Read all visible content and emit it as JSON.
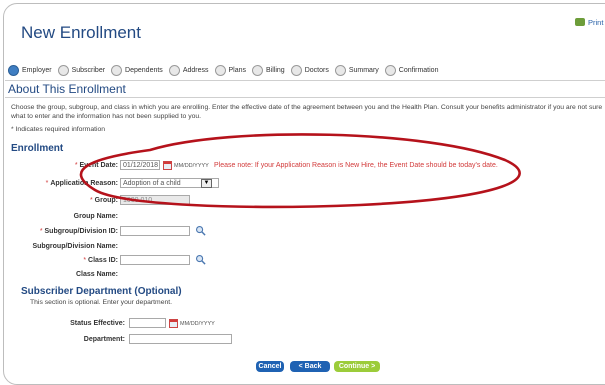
{
  "page": {
    "title": "New Enrollment",
    "print_label": "Print this pa"
  },
  "steps": [
    {
      "label": "Employer",
      "active": true
    },
    {
      "label": "Subscriber",
      "active": false
    },
    {
      "label": "Dependents",
      "active": false
    },
    {
      "label": "Address",
      "active": false
    },
    {
      "label": "Plans",
      "active": false
    },
    {
      "label": "Billing",
      "active": false
    },
    {
      "label": "Doctors",
      "active": false
    },
    {
      "label": "Summary",
      "active": false
    },
    {
      "label": "Confirmation",
      "active": false
    }
  ],
  "section": {
    "title": "About This Enrollment",
    "intro": "Choose the group, subgroup, and class in which you are enrolling. Enter the effective date of the agreement between you and the Health Plan. Consult your benefits administrator if you are not sure what to enter and the information has not been supplied to you.",
    "required_note": "* Indicates required information"
  },
  "enrollment": {
    "heading": "Enrollment",
    "event_date_label": "Event Date:",
    "event_date_value": "01/12/2018",
    "event_date_format": "MM/DD/YYYY",
    "event_date_note": "Please note: If your Application Reason is New Hire, the Event Date should be today's date.",
    "app_reason_label": "Application Reason:",
    "app_reason_value": "Adoption of a child",
    "group_label": "Group:",
    "group_value": "1000 010",
    "group_name_label": "Group Name:",
    "subgroup_id_label": "Subgroup/Division ID:",
    "subgroup_name_label": "Subgroup/Division Name:",
    "class_id_label": "Class ID:",
    "class_name_label": "Class Name:"
  },
  "subscriber_dept": {
    "heading": "Subscriber Department (Optional)",
    "note": "This section is optional. Enter your department.",
    "status_effective_label": "Status Effective:",
    "status_format": "MM/DD/YYYY",
    "department_label": "Department:"
  },
  "buttons": {
    "cancel": "Cancel",
    "back": "< Back",
    "continue": "Continue >"
  },
  "colors": {
    "heading_blue": "#234a83",
    "required_red": "#d23a3a",
    "annotation_oval": "#b5121b",
    "button_blue": "#1f62b3",
    "button_green": "#9ccc3a"
  }
}
